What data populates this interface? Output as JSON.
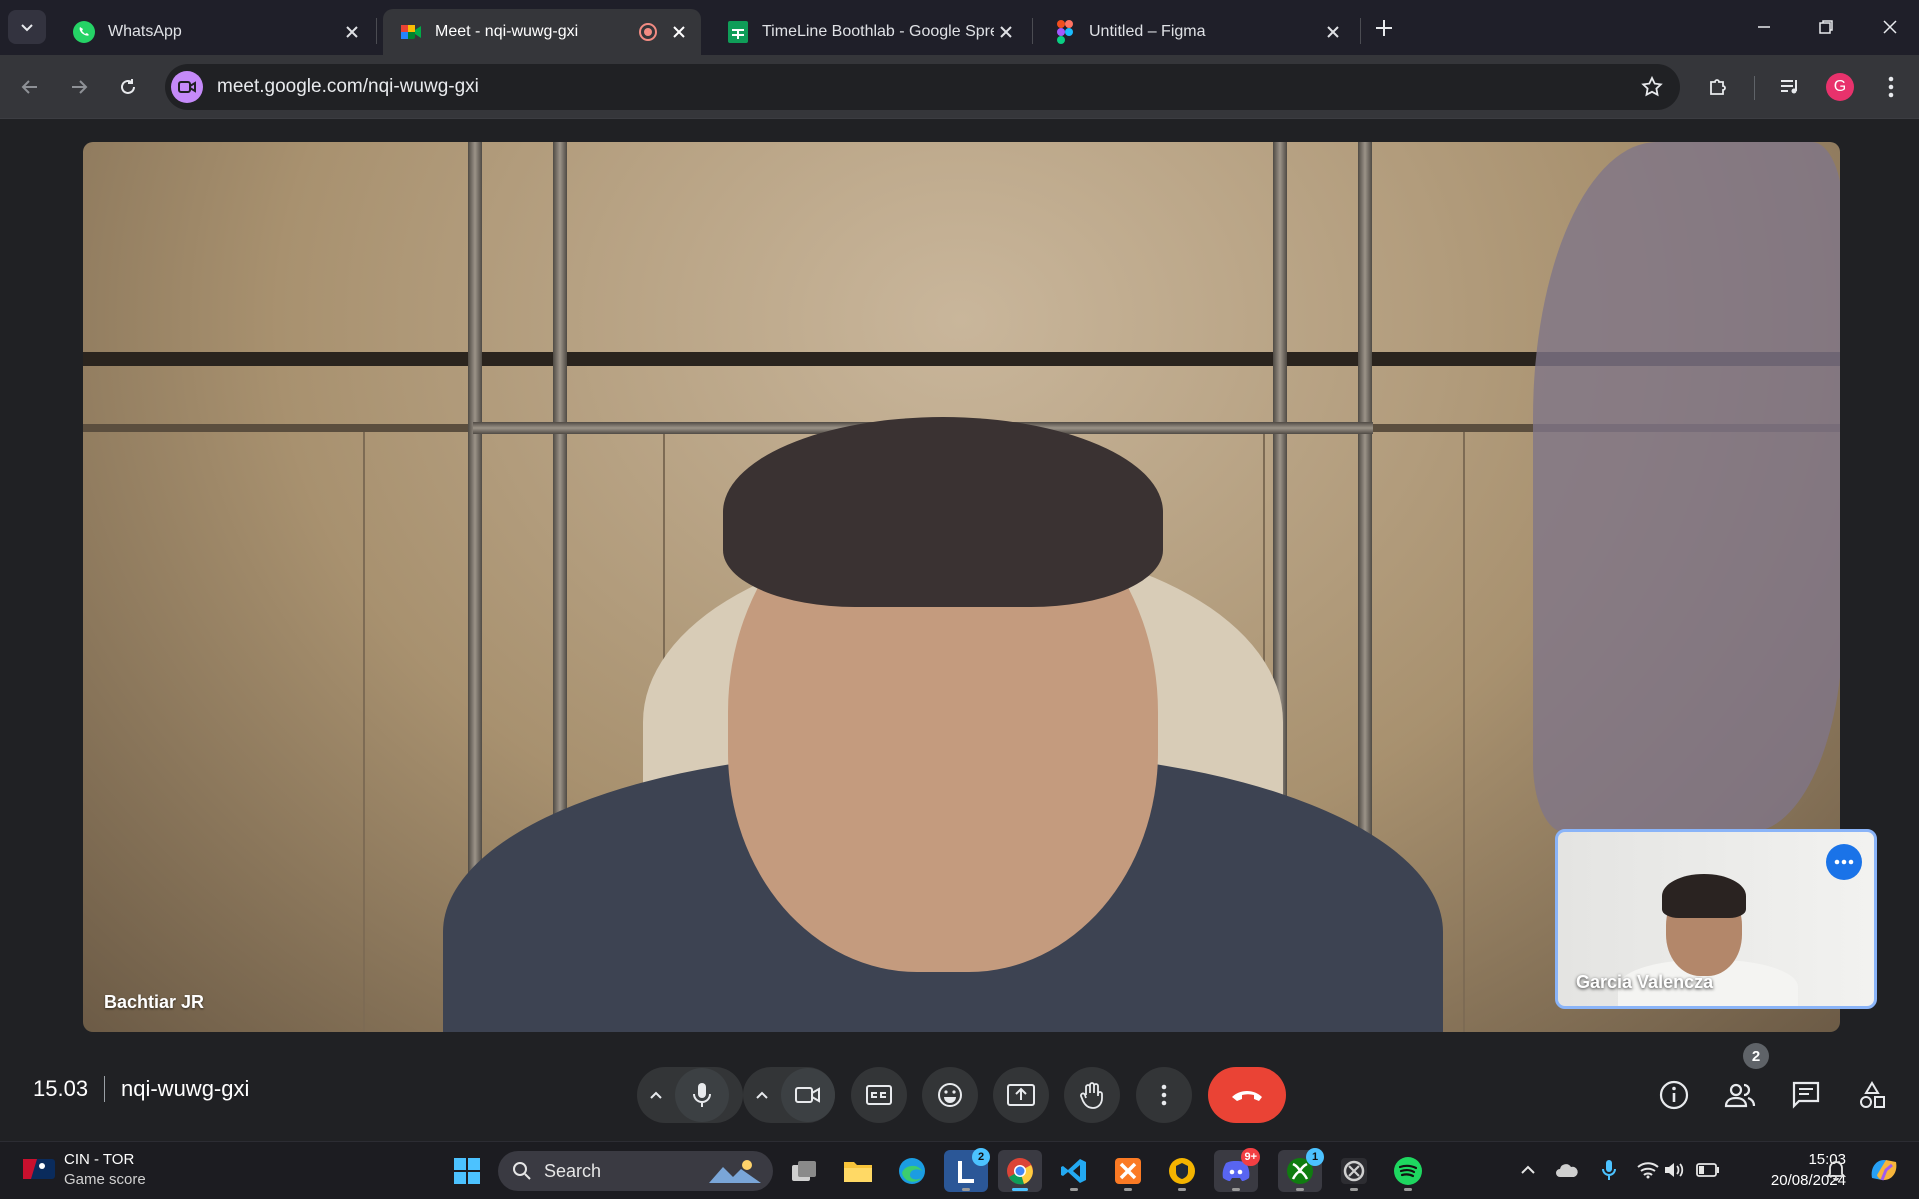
{
  "browser": {
    "tabs": [
      {
        "title": "WhatsApp",
        "icon": "whatsapp-icon",
        "active": false
      },
      {
        "title": "Meet - nqi-wuwg-gxi",
        "icon": "google-meet-icon",
        "active": true,
        "recording": true
      },
      {
        "title": "TimeLine Boothlab - Google Spreadsheet",
        "icon": "google-sheets-icon",
        "active": false
      },
      {
        "title": "Untitled – Figma",
        "icon": "figma-icon",
        "active": false
      }
    ],
    "url": "meet.google.com/nqi-wuwg-gxi",
    "profile_initial": "G"
  },
  "meet": {
    "main_participant": "Bachtiar JR",
    "pip_participant": "Garcia Valencza",
    "time": "15.03",
    "meeting_code": "nqi-wuwg-gxi",
    "participant_count": "2"
  },
  "taskbar": {
    "weather_title": "CIN - TOR",
    "weather_subtitle": "Game score",
    "search_label": "Search",
    "apps": [
      {
        "name": "task-view",
        "badge": ""
      },
      {
        "name": "file-explorer",
        "badge": ""
      },
      {
        "name": "edge",
        "badge": ""
      },
      {
        "name": "l-app",
        "badge": "2"
      },
      {
        "name": "chrome",
        "badge": ""
      },
      {
        "name": "vscode",
        "badge": ""
      },
      {
        "name": "xampp",
        "badge": ""
      },
      {
        "name": "bitwarden",
        "badge": ""
      },
      {
        "name": "discord",
        "badge": "9+"
      },
      {
        "name": "xbox",
        "badge": "1"
      },
      {
        "name": "xbox-gamebar",
        "badge": ""
      },
      {
        "name": "spotify",
        "badge": ""
      }
    ],
    "clock_time": "15:03",
    "clock_date": "20/08/2024"
  },
  "colors": {
    "accent_blue": "#8ab4f8",
    "leave_red": "#ea4335",
    "meet_bg": "#202124"
  }
}
